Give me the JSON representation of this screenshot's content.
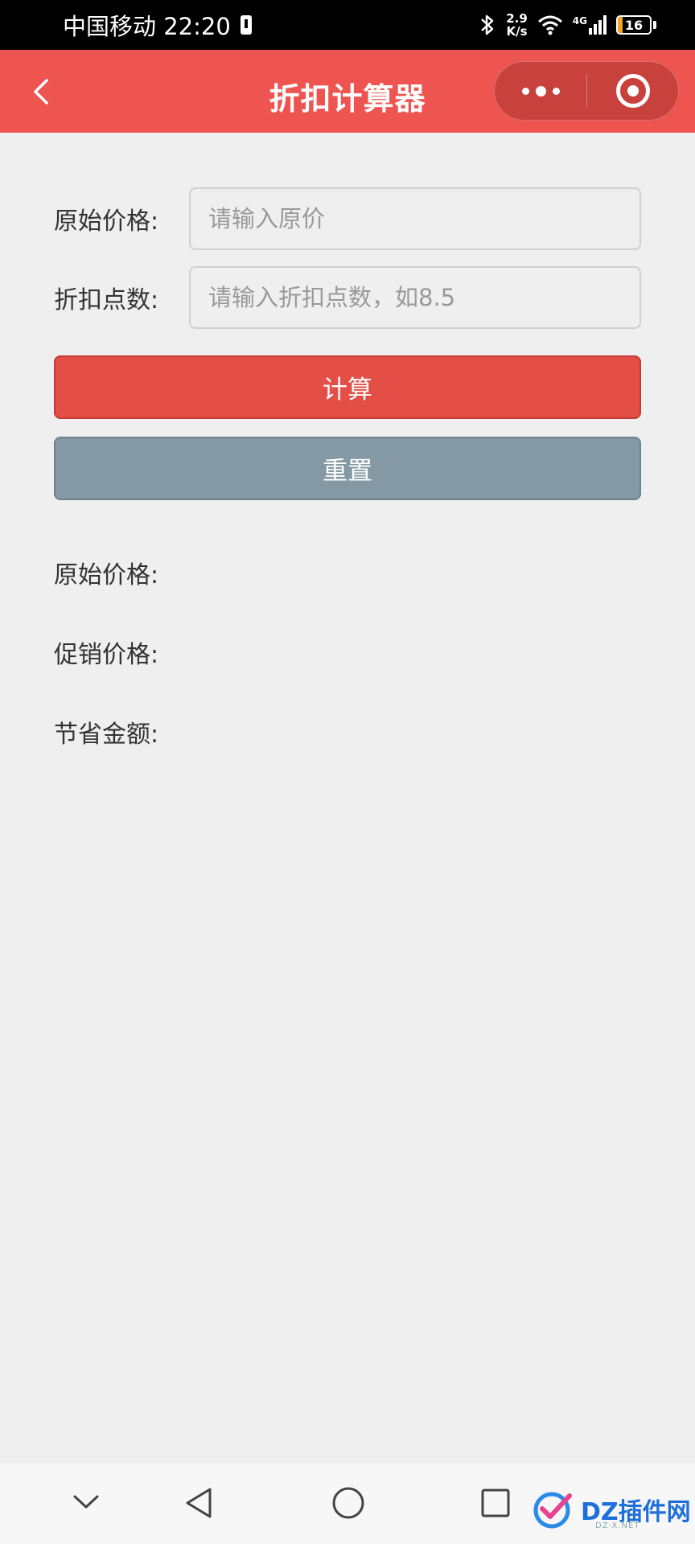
{
  "status_bar": {
    "carrier_time": "中国移动 22:20",
    "net_speed_value": "2.9",
    "net_speed_unit": "K/s",
    "network_type": "4G",
    "battery_level": "16",
    "battery_fraction": 0.16
  },
  "nav": {
    "title": "折扣计算器",
    "back_icon": "chevron-left-icon",
    "more_icon": "more-dots-icon",
    "close_icon": "target-close-icon"
  },
  "form": {
    "price_label": "原始价格:",
    "price_placeholder": "请输入原价",
    "price_value": "",
    "discount_label": "折扣点数:",
    "discount_placeholder": "请输入折扣点数，如8.5",
    "discount_value": ""
  },
  "buttons": {
    "calculate": "计算",
    "reset": "重置"
  },
  "results": {
    "original_label": "原始价格:",
    "original_value": "",
    "promo_label": "促销价格:",
    "promo_value": "",
    "saved_label": "节省金额:",
    "saved_value": ""
  },
  "bottom_nav": {
    "icons": [
      "chevron-down-icon",
      "back-triangle-icon",
      "home-circle-icon",
      "recents-square-icon"
    ]
  },
  "watermark": {
    "text": "DZ插件网",
    "subtext": "DZ-X.NET"
  },
  "colors": {
    "nav_bg": "#ee5450",
    "calculate_bg": "#e34f46",
    "reset_bg": "#8499a3",
    "page_bg": "#efefef"
  }
}
